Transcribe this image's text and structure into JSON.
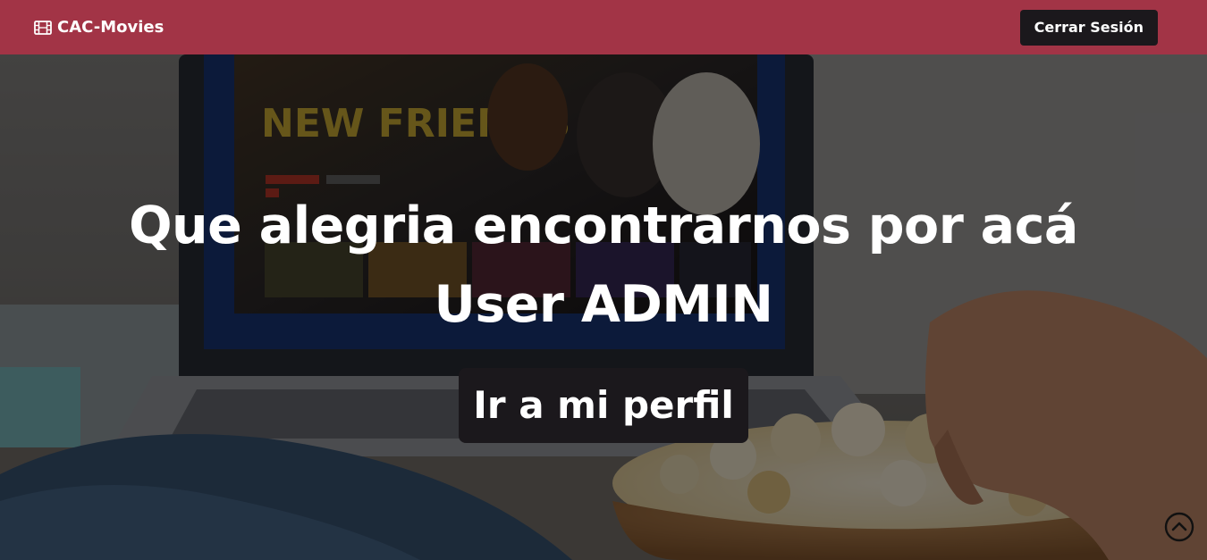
{
  "header": {
    "brand_label": "CAC-Movies",
    "brand_icon": "film-icon",
    "logout_label": "Cerrar Sesión",
    "background_color": "#a23446"
  },
  "hero": {
    "title_line1": "Que alegria encontrarnos por acá",
    "title_line2": "User ADMIN",
    "profile_button_label": "Ir a mi perfil",
    "button_color": "#1b181c",
    "background_image": "person-eating-popcorn-watching-laptop-photo",
    "laptop_screen_title": "NEW FRIENDS"
  },
  "scroll_top": {
    "icon": "chevron-up-circle-icon"
  }
}
